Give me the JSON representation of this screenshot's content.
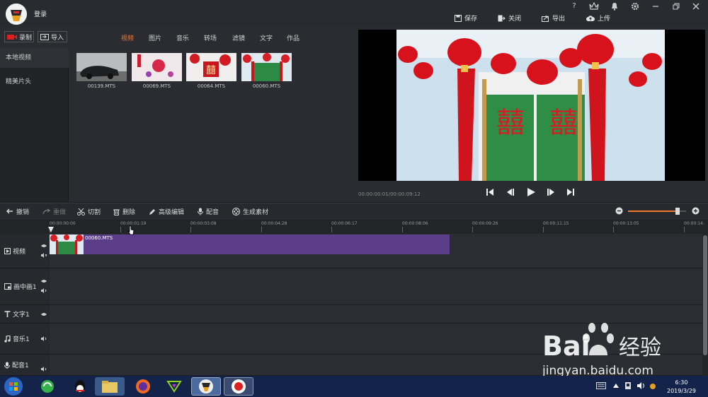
{
  "titlebar": {
    "login": "登录",
    "help_icon": "?",
    "actions": {
      "save": "保存",
      "close": "关闭",
      "export": "导出",
      "upload": "上传"
    }
  },
  "media": {
    "record": "录制",
    "import": "导入",
    "tabs": [
      "视频",
      "图片",
      "音乐",
      "转场",
      "滤镜",
      "文字",
      "作品"
    ],
    "active_tab": "视频",
    "nav": [
      "本地视频",
      "精美片头"
    ],
    "files": [
      "00139.MTS",
      "00069.MTS",
      "00064.MTS",
      "00060.MTS"
    ]
  },
  "preview": {
    "timecode": "00:00:00:01/00:00:09:12"
  },
  "edit": {
    "undo": "撤销",
    "redo": "重做",
    "cut": "切割",
    "delete": "删除",
    "advanced": "高级编辑",
    "dub": "配音",
    "generate": "生成素材",
    "zoom_level": 0.85
  },
  "ruler": {
    "ticks": [
      "00:00:00:00",
      "00:00:01:19",
      "00:00:03:08",
      "00:00:04:28",
      "00:00:06:17",
      "00:00:08:06",
      "00:00:09:26",
      "00:00:11:15",
      "00:00:13:05",
      "00:00:14:"
    ]
  },
  "tracks": {
    "video": "视频",
    "pip": "画中画1",
    "text": "文字1",
    "music": "音乐1",
    "voice": "配音1",
    "clip_name": "00060.MTS"
  },
  "taskbar": {
    "time": "6:30",
    "date": "2019/3/29"
  },
  "watermark": {
    "brand": "Bai",
    "brand_cn": "经验",
    "url": "jingyan.baidu.com"
  },
  "colors": {
    "accent": "#f07a2d",
    "clip": "#5c3d8a",
    "record": "#e02020"
  }
}
